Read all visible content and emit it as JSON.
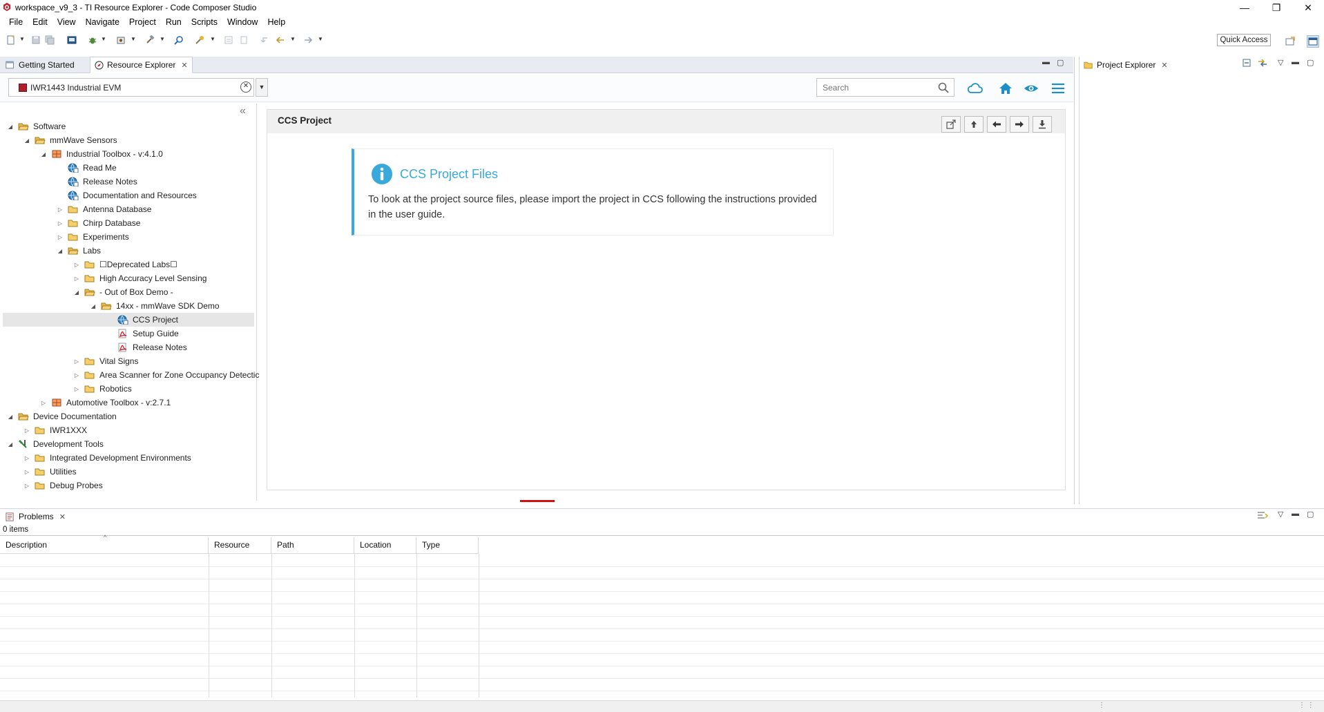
{
  "window": {
    "title": "workspace_v9_3 - TI Resource Explorer - Code Composer Studio",
    "minimize": "—",
    "restore": "❐",
    "close": "✕"
  },
  "menu": [
    "File",
    "Edit",
    "View",
    "Navigate",
    "Project",
    "Run",
    "Scripts",
    "Window",
    "Help"
  ],
  "toolbar": {
    "quick_access": "Quick Access"
  },
  "editor_tabs": {
    "getting_started": "Getting Started",
    "resource_explorer": "Resource Explorer"
  },
  "resource_explorer": {
    "device": "IWR1443 Industrial EVM",
    "search_placeholder": "Search",
    "tree": [
      {
        "label": "Software",
        "depth": 0,
        "twisty": "open",
        "icon": "folder-open"
      },
      {
        "label": "mmWave Sensors",
        "depth": 1,
        "twisty": "open",
        "icon": "folder-open"
      },
      {
        "label": "Industrial Toolbox - v:4.1.0",
        "depth": 2,
        "twisty": "open",
        "icon": "package"
      },
      {
        "label": "Read Me",
        "depth": 3,
        "twisty": "none",
        "icon": "globe"
      },
      {
        "label": "Release Notes",
        "depth": 3,
        "twisty": "none",
        "icon": "globe"
      },
      {
        "label": "Documentation and Resources",
        "depth": 3,
        "twisty": "none",
        "icon": "globe"
      },
      {
        "label": "Antenna Database",
        "depth": 3,
        "twisty": "closed",
        "icon": "folder"
      },
      {
        "label": "Chirp Database",
        "depth": 3,
        "twisty": "closed",
        "icon": "folder"
      },
      {
        "label": "Experiments",
        "depth": 3,
        "twisty": "closed",
        "icon": "folder"
      },
      {
        "label": "Labs",
        "depth": 3,
        "twisty": "open",
        "icon": "folder-open"
      },
      {
        "label": "☐Deprecated Labs☐",
        "depth": 4,
        "twisty": "closed",
        "icon": "folder"
      },
      {
        "label": "High Accuracy Level Sensing",
        "depth": 4,
        "twisty": "closed",
        "icon": "folder"
      },
      {
        "label": "- Out of Box Demo -",
        "depth": 4,
        "twisty": "open",
        "icon": "folder-open"
      },
      {
        "label": "14xx - mmWave SDK Demo",
        "depth": 5,
        "twisty": "open",
        "icon": "folder-open"
      },
      {
        "label": "CCS Project",
        "depth": 6,
        "twisty": "none",
        "icon": "globe",
        "selected": true
      },
      {
        "label": "Setup Guide",
        "depth": 6,
        "twisty": "none",
        "icon": "pdf"
      },
      {
        "label": "Release Notes",
        "depth": 6,
        "twisty": "none",
        "icon": "pdf"
      },
      {
        "label": "Vital Signs",
        "depth": 4,
        "twisty": "closed",
        "icon": "folder"
      },
      {
        "label": "Area Scanner for Zone Occupancy Detectic",
        "depth": 4,
        "twisty": "closed",
        "icon": "folder"
      },
      {
        "label": "Robotics",
        "depth": 4,
        "twisty": "closed",
        "icon": "folder"
      },
      {
        "label": "Automotive Toolbox - v:2.7.1",
        "depth": 2,
        "twisty": "closed",
        "icon": "package"
      },
      {
        "label": "Device Documentation",
        "depth": 0,
        "twisty": "open",
        "icon": "folder-open"
      },
      {
        "label": "IWR1XXX",
        "depth": 1,
        "twisty": "closed",
        "icon": "folder"
      },
      {
        "label": "Development Tools",
        "depth": 0,
        "twisty": "open",
        "icon": "tools"
      },
      {
        "label": "Integrated Development Environments",
        "depth": 1,
        "twisty": "closed",
        "icon": "folder"
      },
      {
        "label": "Utilities",
        "depth": 1,
        "twisty": "closed",
        "icon": "folder"
      },
      {
        "label": "Debug Probes",
        "depth": 1,
        "twisty": "closed",
        "icon": "folder"
      }
    ],
    "content": {
      "title": "CCS Project",
      "callout_title": "CCS Project Files",
      "callout_body": "To look at the project source files, please import the project in CCS following the instructions provided in the user guide."
    }
  },
  "project_explorer": {
    "tab": "Project Explorer"
  },
  "problems": {
    "tab": "Problems",
    "count": "0 items",
    "columns": [
      "Description",
      "Resource",
      "Path",
      "Location",
      "Type"
    ]
  },
  "colors": {
    "accent": "#39a9dc",
    "ti_red": "#b01e2d",
    "icon_blue": "#1b8fc6"
  }
}
